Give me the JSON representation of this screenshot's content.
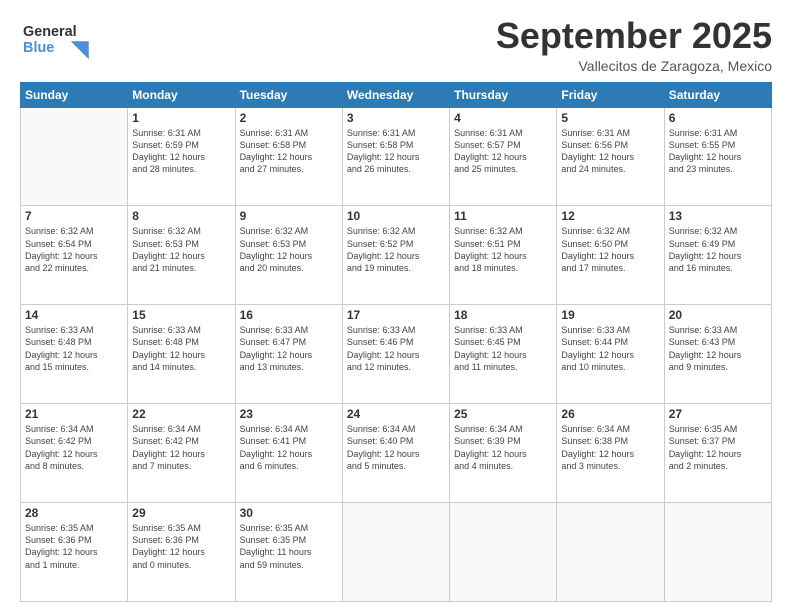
{
  "header": {
    "logo_line1": "General",
    "logo_line2": "Blue",
    "month": "September 2025",
    "location": "Vallecitos de Zaragoza, Mexico"
  },
  "days_of_week": [
    "Sunday",
    "Monday",
    "Tuesday",
    "Wednesday",
    "Thursday",
    "Friday",
    "Saturday"
  ],
  "weeks": [
    [
      {
        "day": "",
        "info": ""
      },
      {
        "day": "1",
        "info": "Sunrise: 6:31 AM\nSunset: 6:59 PM\nDaylight: 12 hours\nand 28 minutes."
      },
      {
        "day": "2",
        "info": "Sunrise: 6:31 AM\nSunset: 6:58 PM\nDaylight: 12 hours\nand 27 minutes."
      },
      {
        "day": "3",
        "info": "Sunrise: 6:31 AM\nSunset: 6:58 PM\nDaylight: 12 hours\nand 26 minutes."
      },
      {
        "day": "4",
        "info": "Sunrise: 6:31 AM\nSunset: 6:57 PM\nDaylight: 12 hours\nand 25 minutes."
      },
      {
        "day": "5",
        "info": "Sunrise: 6:31 AM\nSunset: 6:56 PM\nDaylight: 12 hours\nand 24 minutes."
      },
      {
        "day": "6",
        "info": "Sunrise: 6:31 AM\nSunset: 6:55 PM\nDaylight: 12 hours\nand 23 minutes."
      }
    ],
    [
      {
        "day": "7",
        "info": "Sunrise: 6:32 AM\nSunset: 6:54 PM\nDaylight: 12 hours\nand 22 minutes."
      },
      {
        "day": "8",
        "info": "Sunrise: 6:32 AM\nSunset: 6:53 PM\nDaylight: 12 hours\nand 21 minutes."
      },
      {
        "day": "9",
        "info": "Sunrise: 6:32 AM\nSunset: 6:53 PM\nDaylight: 12 hours\nand 20 minutes."
      },
      {
        "day": "10",
        "info": "Sunrise: 6:32 AM\nSunset: 6:52 PM\nDaylight: 12 hours\nand 19 minutes."
      },
      {
        "day": "11",
        "info": "Sunrise: 6:32 AM\nSunset: 6:51 PM\nDaylight: 12 hours\nand 18 minutes."
      },
      {
        "day": "12",
        "info": "Sunrise: 6:32 AM\nSunset: 6:50 PM\nDaylight: 12 hours\nand 17 minutes."
      },
      {
        "day": "13",
        "info": "Sunrise: 6:32 AM\nSunset: 6:49 PM\nDaylight: 12 hours\nand 16 minutes."
      }
    ],
    [
      {
        "day": "14",
        "info": "Sunrise: 6:33 AM\nSunset: 6:48 PM\nDaylight: 12 hours\nand 15 minutes."
      },
      {
        "day": "15",
        "info": "Sunrise: 6:33 AM\nSunset: 6:48 PM\nDaylight: 12 hours\nand 14 minutes."
      },
      {
        "day": "16",
        "info": "Sunrise: 6:33 AM\nSunset: 6:47 PM\nDaylight: 12 hours\nand 13 minutes."
      },
      {
        "day": "17",
        "info": "Sunrise: 6:33 AM\nSunset: 6:46 PM\nDaylight: 12 hours\nand 12 minutes."
      },
      {
        "day": "18",
        "info": "Sunrise: 6:33 AM\nSunset: 6:45 PM\nDaylight: 12 hours\nand 11 minutes."
      },
      {
        "day": "19",
        "info": "Sunrise: 6:33 AM\nSunset: 6:44 PM\nDaylight: 12 hours\nand 10 minutes."
      },
      {
        "day": "20",
        "info": "Sunrise: 6:33 AM\nSunset: 6:43 PM\nDaylight: 12 hours\nand 9 minutes."
      }
    ],
    [
      {
        "day": "21",
        "info": "Sunrise: 6:34 AM\nSunset: 6:42 PM\nDaylight: 12 hours\nand 8 minutes."
      },
      {
        "day": "22",
        "info": "Sunrise: 6:34 AM\nSunset: 6:42 PM\nDaylight: 12 hours\nand 7 minutes."
      },
      {
        "day": "23",
        "info": "Sunrise: 6:34 AM\nSunset: 6:41 PM\nDaylight: 12 hours\nand 6 minutes."
      },
      {
        "day": "24",
        "info": "Sunrise: 6:34 AM\nSunset: 6:40 PM\nDaylight: 12 hours\nand 5 minutes."
      },
      {
        "day": "25",
        "info": "Sunrise: 6:34 AM\nSunset: 6:39 PM\nDaylight: 12 hours\nand 4 minutes."
      },
      {
        "day": "26",
        "info": "Sunrise: 6:34 AM\nSunset: 6:38 PM\nDaylight: 12 hours\nand 3 minutes."
      },
      {
        "day": "27",
        "info": "Sunrise: 6:35 AM\nSunset: 6:37 PM\nDaylight: 12 hours\nand 2 minutes."
      }
    ],
    [
      {
        "day": "28",
        "info": "Sunrise: 6:35 AM\nSunset: 6:36 PM\nDaylight: 12 hours\nand 1 minute."
      },
      {
        "day": "29",
        "info": "Sunrise: 6:35 AM\nSunset: 6:36 PM\nDaylight: 12 hours\nand 0 minutes."
      },
      {
        "day": "30",
        "info": "Sunrise: 6:35 AM\nSunset: 6:35 PM\nDaylight: 11 hours\nand 59 minutes."
      },
      {
        "day": "",
        "info": ""
      },
      {
        "day": "",
        "info": ""
      },
      {
        "day": "",
        "info": ""
      },
      {
        "day": "",
        "info": ""
      }
    ]
  ]
}
